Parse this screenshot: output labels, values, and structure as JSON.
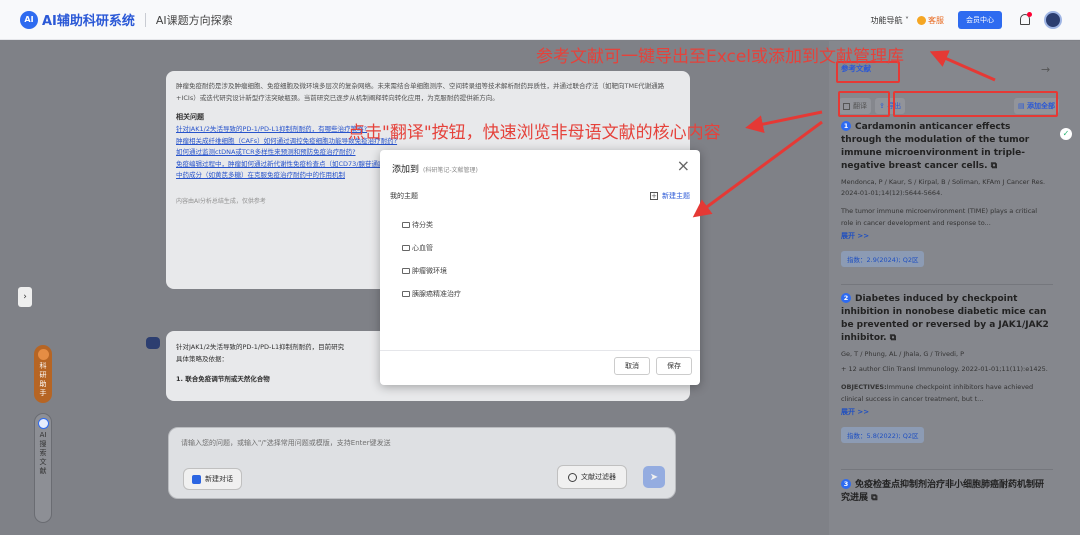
{
  "header": {
    "logo_text": "AI",
    "app_title": "AI辅助科研系统",
    "subtitle": "AI课题方向探索",
    "nav": "功能导航",
    "kefu": "客服",
    "member": "会员中心"
  },
  "chat": {
    "summary": "肿瘤免疫耐药是涉及肿瘤细胞、免疫细胞及微环境多层次的复杂网络。未来需结合单细胞测序、空间转录组等技术解析耐药异质性，并通过联合疗法（如靶向TME代谢通路+ICIs）或迭代研究设计新型疗法突破瓶颈。当前研究已逐步从机制阐释转向转化应用，为克服耐药提供新方向。",
    "related_title": "相关问题",
    "related": [
      "针对JAK1/2失活导致的PD-1/PD-L1抑制剂耐药，有哪些治疗策略?",
      "肿瘤相关成纤维细胞（CAFs）如何通过调控免疫细胞功能导致免疫治疗耐药?",
      "如何通过监测ctDNA或TCR多样性来预测和预防免疫治疗耐药?",
      "免疫编辑过程中，肿瘤如何通过新代谢性免疫检查点（如CD73/腺苷通路）逃避免疫?",
      "中药成分（如黄芪多糖）在克服免疫治疗耐药中的作用机制"
    ],
    "note": "内容由AI分析总结生成，仅供参考",
    "q2_intro": "针对JAK1/2失活导致的PD-1/PD-L1抑制剂耐药，目前研究",
    "q2_line2": "具体策略及依据：",
    "q2_point": "1. 联合免疫调节剂或天然化合物",
    "input_placeholder": "请输入您的问题，或输入\"/\"选择常用问题或模版，支持Enter键发送",
    "new_chat": "新建对话",
    "lit_filter": "文献过滤器",
    "expand": "›",
    "pill_orange": [
      "科",
      "研",
      "助",
      "手"
    ],
    "pill_grey": [
      "AI",
      "搜",
      "索",
      "文",
      "献"
    ]
  },
  "sidebar": {
    "tab": "参考文献",
    "collapse": "→",
    "translate": "翻译",
    "export": "导出",
    "add_all": "添加全部",
    "refs": [
      {
        "num": "1",
        "title": "Cardamonin anticancer effects through the modulation of the tumor immune microenvironment in triple-negative breast cancer cells.",
        "authors": "Mendonca, P / Kaur, S / Kirpal, B / Soliman, KFAm J Cancer Res. 2024-01-01;14(12):5644-5664.",
        "abstract": "The tumor immune microenvironment (TIME) plays a critical role in cancer development and response to...",
        "more": "展开 >>",
        "impact": "指数：2.9(2024); Q2区"
      },
      {
        "num": "2",
        "title": "Diabetes induced by checkpoint inhibition in nonobese diabetic mice can be prevented or reversed by a JAK1/JAK2 inhibitor.",
        "authors": "Ge, T / Phung, AL / Jhala, G / Trivedi, P",
        "authors2": "+ 12 author   Clin Transl Immunology. 2022-01-01;11(11):e1425.",
        "abstract_label": "OBJECTIVES:",
        "abstract": "Immune checkpoint inhibitors have achieved clinical success in cancer treatment, but t...",
        "more": "展开 >>",
        "impact": "指数：5.8(2022); Q2区"
      },
      {
        "num": "3",
        "title": "免疫检查点抑制剂治疗非小细胞肺癌耐药机制研究进展"
      }
    ]
  },
  "modal": {
    "title": "添加到",
    "subtitle": "(科研笔记-文献管理)",
    "close": "×",
    "label": "我的主题",
    "new_topic": "新建主题",
    "topics": [
      "待分类",
      "心血管",
      "肿瘤微环境",
      "胰腺癌精准治疗"
    ],
    "cancel": "取消",
    "save": "保存"
  },
  "annotations": {
    "export_note": "参考文献可一键导出至Excel或添加到文献管理库",
    "translate_note": "点击\"翻译\"按钮，快速浏览非母语文献的核心内容",
    "color": "#e5423b"
  }
}
